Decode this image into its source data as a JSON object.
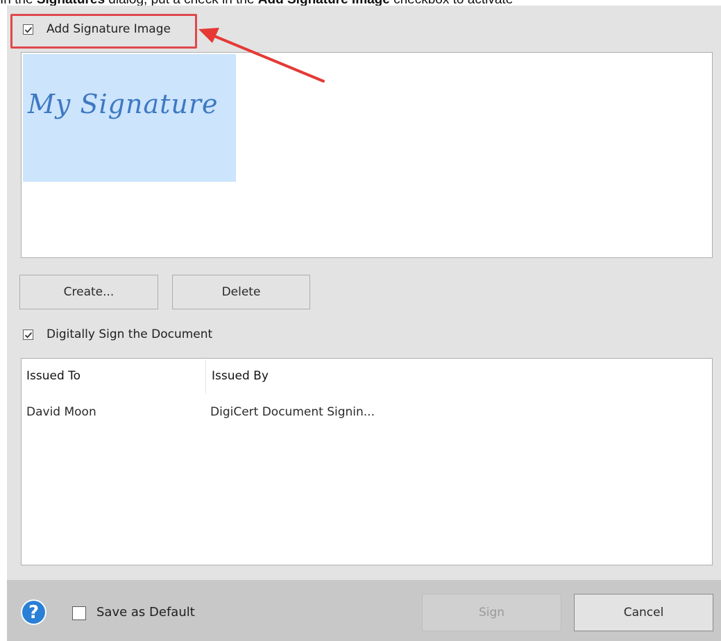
{
  "top_text": {
    "pre": "In the ",
    "bold1": "Signatures",
    "mid": " dialog, put a check in the ",
    "bold2": "Add Signature Image",
    "post": " checkbox to activate"
  },
  "add_image": {
    "checked": true,
    "label": "Add Signature Image"
  },
  "signature_preview": {
    "text": "My Signature",
    "bg_color": "#cce4fc",
    "ink_color": "#3d78c2"
  },
  "buttons": {
    "create": "Create...",
    "delete": "Delete",
    "sign": "Sign",
    "cancel": "Cancel"
  },
  "digital_sign": {
    "checked": true,
    "label": "Digitally Sign the Document"
  },
  "cert_table": {
    "headers": [
      "Issued To",
      "Issued By"
    ],
    "rows": [
      [
        "David Moon",
        "DigiCert Document Signin..."
      ]
    ]
  },
  "footer": {
    "help_icon": "?",
    "save_default_label": "Save as Default",
    "save_default_checked": false
  },
  "annotation": {
    "highlight_color": "#e0474c",
    "arrow_color": "#e53935"
  }
}
